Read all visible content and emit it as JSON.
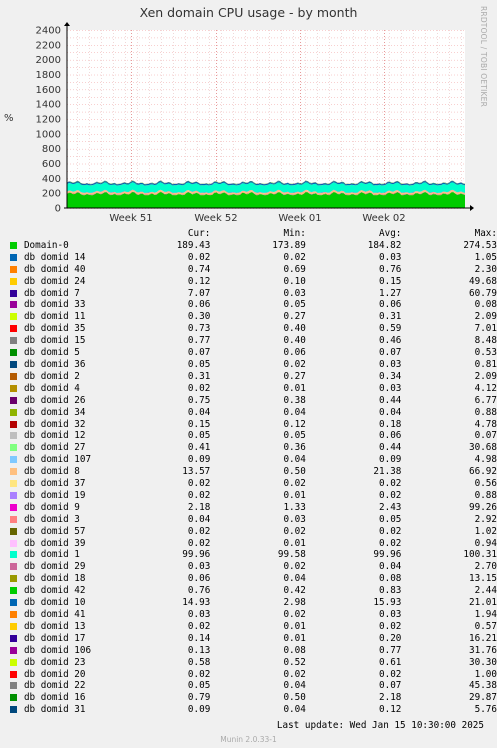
{
  "chart_data": {
    "type": "area",
    "title": "Xen domain CPU usage - by month",
    "ylabel": "%",
    "ylim": [
      0,
      2400
    ],
    "yticks": [
      0,
      200,
      400,
      600,
      800,
      1000,
      1200,
      1400,
      1600,
      1800,
      2000,
      2200,
      2400
    ],
    "xtick_labels": [
      "Week 51",
      "Week 52",
      "Week 01",
      "Week 02"
    ],
    "grid": true,
    "stacked": true,
    "columns": [
      "Cur:",
      "Min:",
      "Avg:",
      "Max:"
    ],
    "series": [
      {
        "name": "Domain-0",
        "color": "#00cc00",
        "cur": "189.43",
        "min": "173.89",
        "avg": "184.82",
        "max": "274.53"
      },
      {
        "name": "db domid 14",
        "color": "#0066b3",
        "cur": "0.02",
        "min": "0.02",
        "avg": "0.03",
        "max": "1.05"
      },
      {
        "name": "db domid 40",
        "color": "#ff8000",
        "cur": "0.74",
        "min": "0.69",
        "avg": "0.76",
        "max": "2.30"
      },
      {
        "name": "db domid 24",
        "color": "#ffcc00",
        "cur": "0.12",
        "min": "0.10",
        "avg": "0.15",
        "max": "49.68"
      },
      {
        "name": "db domid 7",
        "color": "#330099",
        "cur": "7.07",
        "min": "0.03",
        "avg": "1.27",
        "max": "60.79"
      },
      {
        "name": "db domid 33",
        "color": "#990099",
        "cur": "0.06",
        "min": "0.05",
        "avg": "0.06",
        "max": "0.08"
      },
      {
        "name": "db domid 11",
        "color": "#ccff00",
        "cur": "0.30",
        "min": "0.27",
        "avg": "0.31",
        "max": "2.09"
      },
      {
        "name": "db domid 35",
        "color": "#ff0000",
        "cur": "0.73",
        "min": "0.40",
        "avg": "0.59",
        "max": "7.01"
      },
      {
        "name": "db domid 15",
        "color": "#808080",
        "cur": "0.77",
        "min": "0.40",
        "avg": "0.46",
        "max": "8.48"
      },
      {
        "name": "db domid 5",
        "color": "#008f00",
        "cur": "0.07",
        "min": "0.06",
        "avg": "0.07",
        "max": "0.53"
      },
      {
        "name": "db domid 36",
        "color": "#00487d",
        "cur": "0.05",
        "min": "0.02",
        "avg": "0.03",
        "max": "0.81"
      },
      {
        "name": "db domid 2",
        "color": "#b35a00",
        "cur": "0.31",
        "min": "0.27",
        "avg": "0.34",
        "max": "2.09"
      },
      {
        "name": "db domid 4",
        "color": "#b38f00",
        "cur": "0.02",
        "min": "0.01",
        "avg": "0.03",
        "max": "4.12"
      },
      {
        "name": "db domid 26",
        "color": "#6b006b",
        "cur": "0.75",
        "min": "0.38",
        "avg": "0.44",
        "max": "6.77"
      },
      {
        "name": "db domid 34",
        "color": "#8fb300",
        "cur": "0.04",
        "min": "0.04",
        "avg": "0.04",
        "max": "0.88"
      },
      {
        "name": "db domid 32",
        "color": "#b30000",
        "cur": "0.15",
        "min": "0.12",
        "avg": "0.18",
        "max": "4.78"
      },
      {
        "name": "db domid 12",
        "color": "#bebebe",
        "cur": "0.05",
        "min": "0.05",
        "avg": "0.06",
        "max": "0.07"
      },
      {
        "name": "db domid 27",
        "color": "#80ff80",
        "cur": "0.41",
        "min": "0.36",
        "avg": "0.44",
        "max": "30.68"
      },
      {
        "name": "db domid 107",
        "color": "#80c9ff",
        "cur": "0.09",
        "min": "0.04",
        "avg": "0.09",
        "max": "4.98"
      },
      {
        "name": "db domid 8",
        "color": "#ffc080",
        "cur": "13.57",
        "min": "0.50",
        "avg": "21.38",
        "max": "66.92"
      },
      {
        "name": "db domid 37",
        "color": "#ffe680",
        "cur": "0.02",
        "min": "0.02",
        "avg": "0.02",
        "max": "0.56"
      },
      {
        "name": "db domid 19",
        "color": "#aa80ff",
        "cur": "0.02",
        "min": "0.01",
        "avg": "0.02",
        "max": "0.88"
      },
      {
        "name": "db domid 9",
        "color": "#ee00cc",
        "cur": "2.18",
        "min": "1.33",
        "avg": "2.43",
        "max": "99.26"
      },
      {
        "name": "db domid 3",
        "color": "#ff8080",
        "cur": "0.04",
        "min": "0.03",
        "avg": "0.05",
        "max": "2.92"
      },
      {
        "name": "db domid 57",
        "color": "#666600",
        "cur": "0.02",
        "min": "0.02",
        "avg": "0.02",
        "max": "1.02"
      },
      {
        "name": "db domid 39",
        "color": "#ffbfff",
        "cur": "0.02",
        "min": "0.01",
        "avg": "0.02",
        "max": "0.94"
      },
      {
        "name": "db domid 1",
        "color": "#00ffcc",
        "cur": "99.96",
        "min": "99.58",
        "avg": "99.96",
        "max": "100.31"
      },
      {
        "name": "db domid 29",
        "color": "#cc6699",
        "cur": "0.03",
        "min": "0.02",
        "avg": "0.04",
        "max": "2.70"
      },
      {
        "name": "db domid 18",
        "color": "#999900",
        "cur": "0.06",
        "min": "0.04",
        "avg": "0.08",
        "max": "13.15"
      },
      {
        "name": "db domid 42",
        "color": "#00cc00",
        "cur": "0.76",
        "min": "0.42",
        "avg": "0.83",
        "max": "2.44"
      },
      {
        "name": "db domid 10",
        "color": "#0066b3",
        "cur": "14.93",
        "min": "2.98",
        "avg": "15.93",
        "max": "21.01"
      },
      {
        "name": "db domid 41",
        "color": "#ff8000",
        "cur": "0.03",
        "min": "0.02",
        "avg": "0.03",
        "max": "1.94"
      },
      {
        "name": "db domid 13",
        "color": "#ffcc00",
        "cur": "0.02",
        "min": "0.01",
        "avg": "0.02",
        "max": "0.57"
      },
      {
        "name": "db domid 17",
        "color": "#330099",
        "cur": "0.14",
        "min": "0.01",
        "avg": "0.20",
        "max": "16.21"
      },
      {
        "name": "db domid 106",
        "color": "#990099",
        "cur": "0.13",
        "min": "0.08",
        "avg": "0.77",
        "max": "31.76"
      },
      {
        "name": "db domid 23",
        "color": "#ccff00",
        "cur": "0.58",
        "min": "0.52",
        "avg": "0.61",
        "max": "30.30"
      },
      {
        "name": "db domid 20",
        "color": "#ff0000",
        "cur": "0.02",
        "min": "0.02",
        "avg": "0.02",
        "max": "1.00"
      },
      {
        "name": "db domid 22",
        "color": "#808080",
        "cur": "0.05",
        "min": "0.04",
        "avg": "0.07",
        "max": "45.38"
      },
      {
        "name": "db domid 16",
        "color": "#008f00",
        "cur": "0.79",
        "min": "0.50",
        "avg": "2.18",
        "max": "29.87"
      },
      {
        "name": "db domid 31",
        "color": "#00487d",
        "cur": "0.09",
        "min": "0.04",
        "avg": "0.12",
        "max": "5.76"
      }
    ]
  },
  "watermark": "RRDTOOL / TOBI OETIKER",
  "last_update": "Last update:  Wed Jan 15 10:30:00 2025",
  "footer": "Munin 2.0.33-1"
}
